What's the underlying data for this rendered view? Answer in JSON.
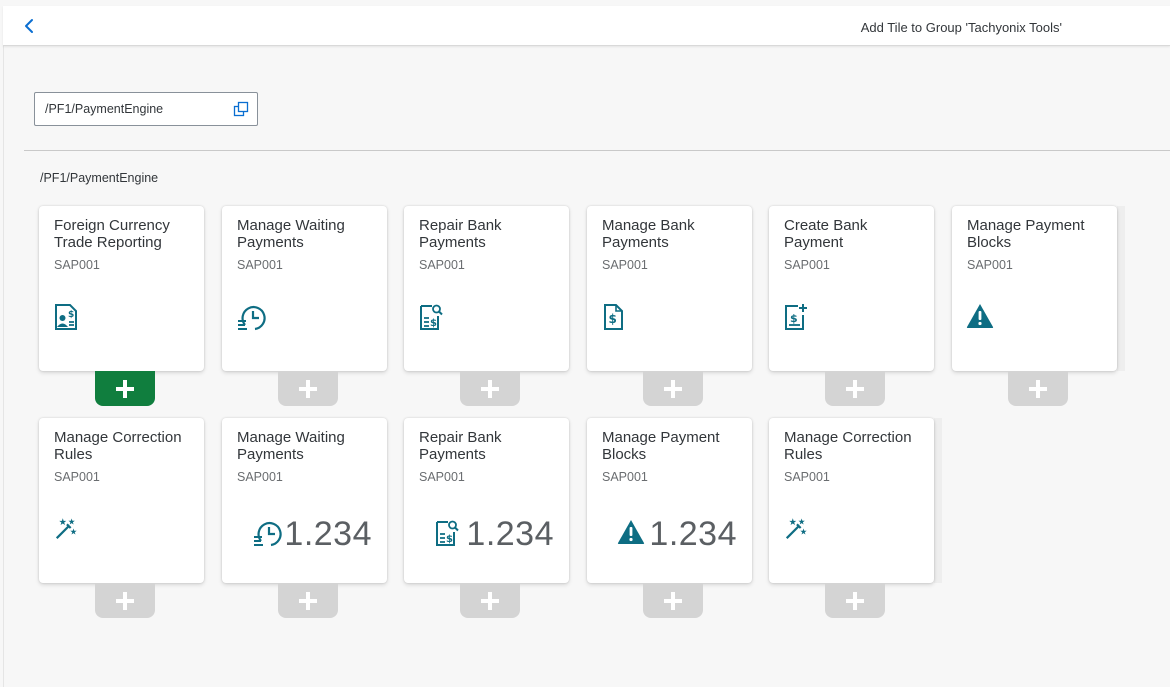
{
  "header": {
    "title": "Add Tile to Group 'Tachyonix Tools'"
  },
  "catalog_selector": {
    "value": "/PF1/PaymentEngine"
  },
  "section": {
    "title": "/PF1/PaymentEngine"
  },
  "colors": {
    "icon": "#0a6ed1",
    "icon_teal": "#0e7a8a",
    "add_active": "#107e3e",
    "add_inactive": "#d4d4d4"
  },
  "tiles": [
    {
      "title": "Foreign Currency Trade Reporting",
      "subtitle": "SAP001",
      "icon": "document-person-dollar-icon",
      "added": true
    },
    {
      "title": "Manage Waiting Payments",
      "subtitle": "SAP001",
      "icon": "list-clock-icon",
      "added": false
    },
    {
      "title": "Repair Bank Payments",
      "subtitle": "SAP001",
      "icon": "document-search-dollar-icon",
      "added": false
    },
    {
      "title": "Manage Bank Payments",
      "subtitle": "SAP001",
      "icon": "document-dollar-icon",
      "added": false
    },
    {
      "title": "Create Bank Payment",
      "subtitle": "SAP001",
      "icon": "document-add-dollar-icon",
      "added": false
    },
    {
      "title": "Manage Payment Blocks",
      "subtitle": "SAP001",
      "icon": "alert-icon",
      "added": false
    },
    {
      "title": "Manage Correction Rules",
      "subtitle": "SAP001",
      "icon": "magic-wand-icon",
      "added": false
    },
    {
      "title": "Manage Waiting Payments",
      "subtitle": "SAP001",
      "icon": "list-clock-icon",
      "number": "1.234",
      "added": false
    },
    {
      "title": "Repair Bank Payments",
      "subtitle": "SAP001",
      "icon": "document-search-dollar-icon",
      "number": "1.234",
      "added": false
    },
    {
      "title": "Manage Payment Blocks",
      "subtitle": "SAP001",
      "icon": "alert-icon",
      "number": "1.234",
      "added": false
    },
    {
      "title": "Manage Correction Rules",
      "subtitle": "SAP001",
      "icon": "magic-wand-icon",
      "added": false
    }
  ]
}
